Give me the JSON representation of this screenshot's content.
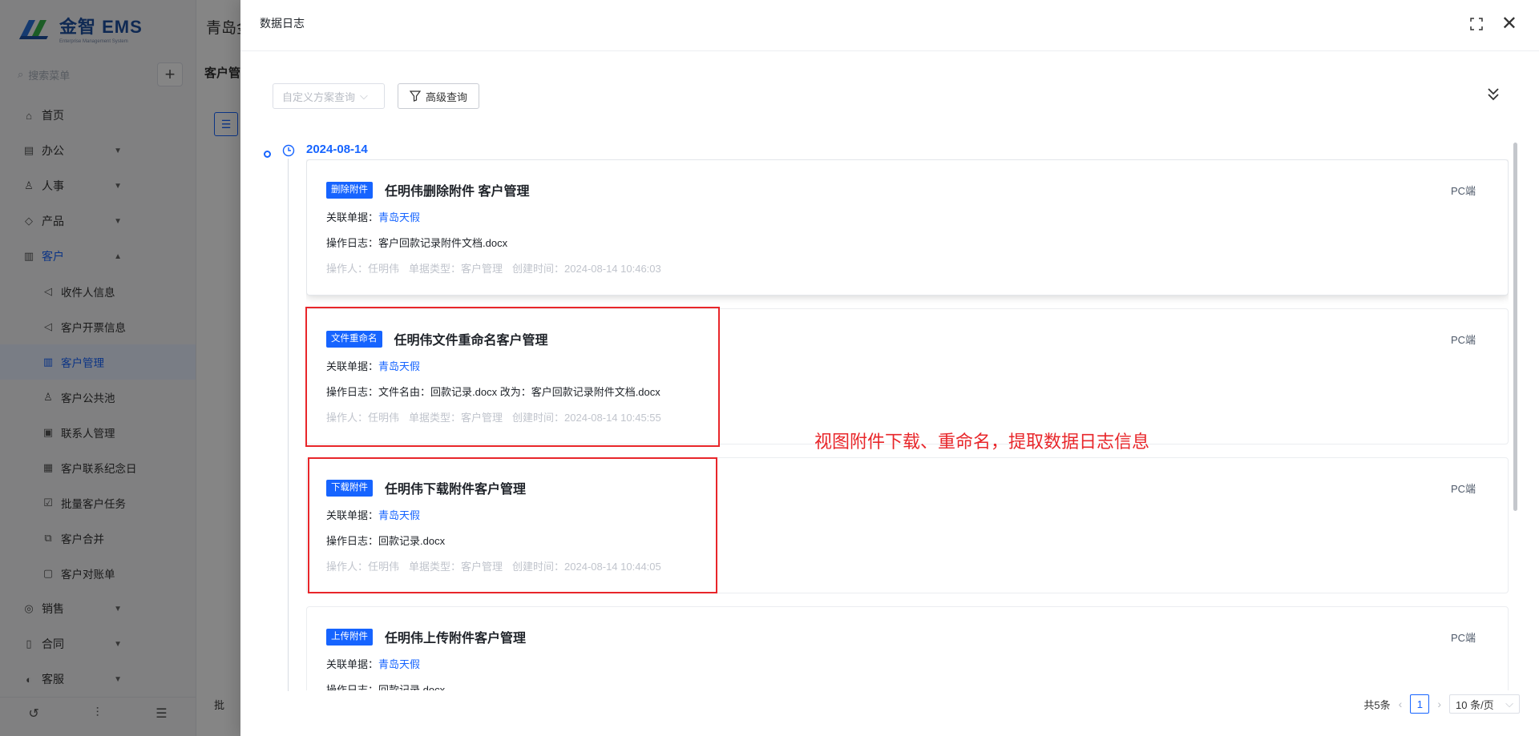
{
  "app": {
    "logo_title": "金智 EMS",
    "logo_subtitle": "Enterprise Management System",
    "search_placeholder": "搜索菜单",
    "company_title": "青岛金",
    "page_tab": "客户管",
    "footer_text": "批"
  },
  "sidebar": {
    "items": [
      {
        "label": "首页",
        "icon": "home-icon"
      },
      {
        "label": "办公",
        "icon": "office-icon",
        "arrow": "chevron-down"
      },
      {
        "label": "人事",
        "icon": "people-icon",
        "arrow": "chevron-down"
      },
      {
        "label": "产品",
        "icon": "product-icon",
        "arrow": "chevron-down"
      },
      {
        "label": "客户",
        "icon": "customer-icon",
        "arrow": "chevron-up"
      },
      {
        "label": "收件人信息",
        "icon": "recipient-icon"
      },
      {
        "label": "客户开票信息",
        "icon": "invoice-icon"
      },
      {
        "label": "客户管理",
        "icon": "customer-manage-icon"
      },
      {
        "label": "客户公共池",
        "icon": "pool-icon"
      },
      {
        "label": "联系人管理",
        "icon": "contact-icon"
      },
      {
        "label": "客户联系纪念日",
        "icon": "calendar-icon"
      },
      {
        "label": "批量客户任务",
        "icon": "task-icon"
      },
      {
        "label": "客户合并",
        "icon": "merge-icon"
      },
      {
        "label": "客户对账单",
        "icon": "statement-icon"
      },
      {
        "label": "销售",
        "icon": "sales-icon",
        "arrow": "chevron-down"
      },
      {
        "label": "合同",
        "icon": "contract-icon",
        "arrow": "chevron-down"
      },
      {
        "label": "客服",
        "icon": "service-icon",
        "arrow": "chevron-down"
      }
    ]
  },
  "drawer": {
    "title": "数据日志",
    "scheme_placeholder": "自定义方案查询",
    "advanced_label": "高级查询",
    "date": "2024-08-14",
    "related_label": "关联单据：",
    "log_label": "操作日志：",
    "cards": [
      {
        "tag": "删除附件",
        "title": "任明伟删除附件   客户管理",
        "source": "PC端",
        "related": "青岛天假",
        "log": "客户回款记录附件文档.docx",
        "operator": "操作人：任明伟",
        "doc_type": "单据类型：客户管理",
        "created": "创建时间：2024-08-14 10:46:03"
      },
      {
        "tag": "文件重命名",
        "title": "任明伟文件重命名客户管理",
        "source": "PC端",
        "related": "青岛天假",
        "log": "文件名由：回款记录.docx 改为：客户回款记录附件文档.docx",
        "operator": "操作人：任明伟",
        "doc_type": "单据类型：客户管理",
        "created": "创建时间：2024-08-14 10:45:55"
      },
      {
        "tag": "下载附件",
        "title": "任明伟下载附件客户管理",
        "source": "PC端",
        "related": "青岛天假",
        "log": "回款记录.docx",
        "operator": "操作人：任明伟",
        "doc_type": "单据类型：客户管理",
        "created": "创建时间：2024-08-14 10:44:05"
      },
      {
        "tag": "上传附件",
        "title": "任明伟上传附件客户管理",
        "source": "PC端",
        "related": "青岛天假",
        "log": "回款记录.docx",
        "operator": "",
        "doc_type": "",
        "created": ""
      }
    ],
    "annotation": "视图附件下载、重命名，提取数据日志信息",
    "pagination": {
      "total": "共5条",
      "current_page": "1",
      "page_size": "10 条/页"
    }
  },
  "colors": {
    "primary": "#1664ff",
    "annotation_red": "#e8262a",
    "overlay": "rgba(0,0,0,0.48)"
  }
}
